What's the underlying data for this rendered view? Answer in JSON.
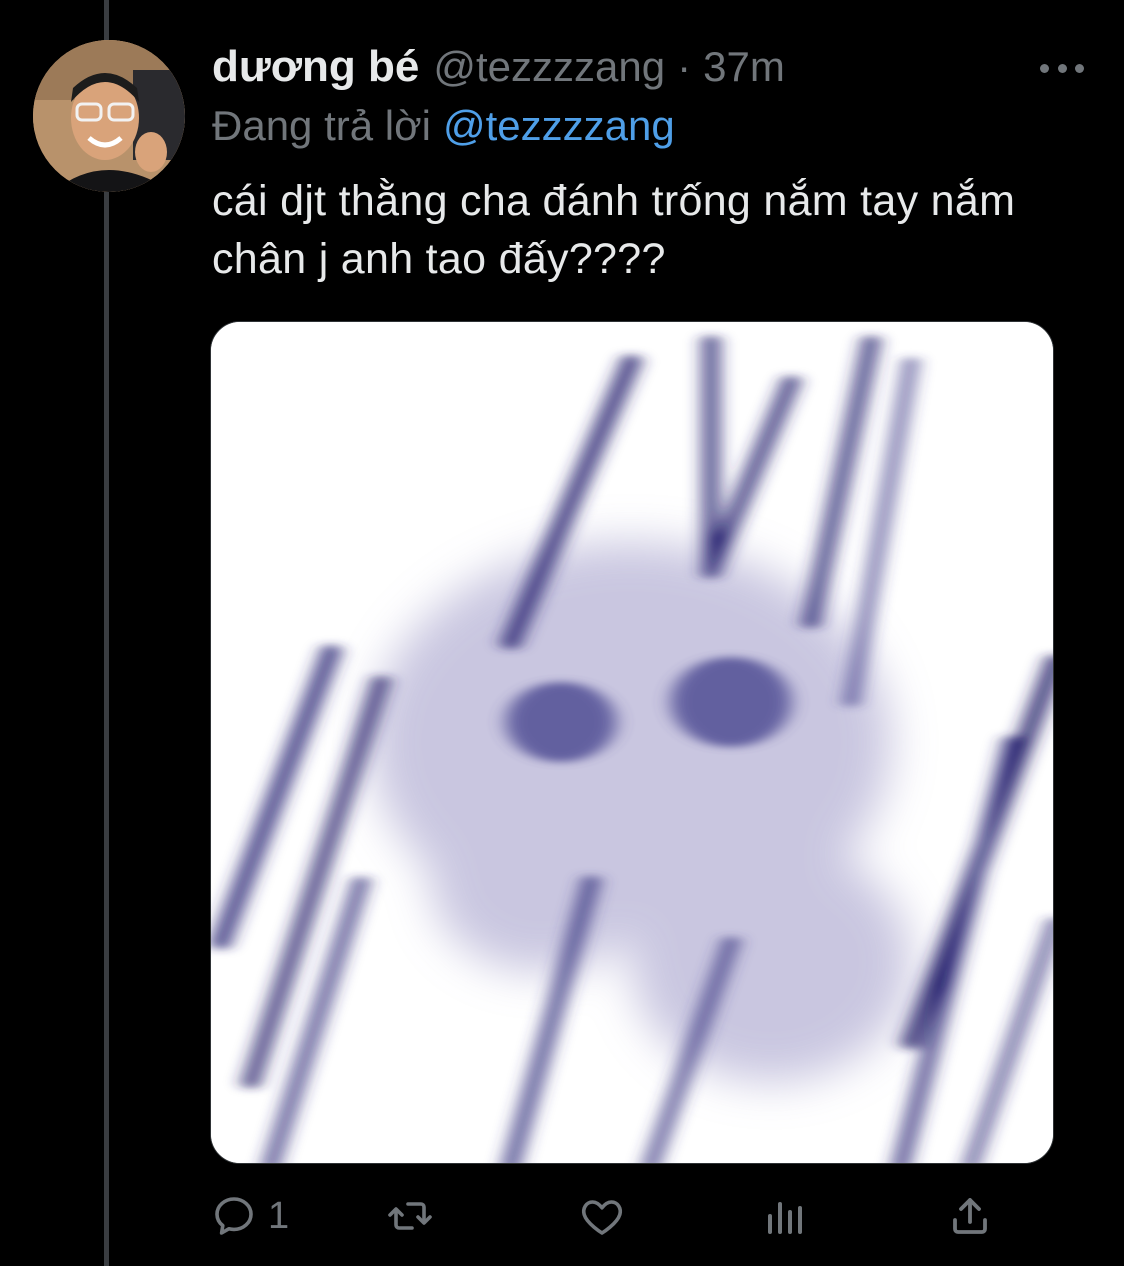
{
  "tweet": {
    "display_name": "dương bé",
    "handle": "@tezzzzang",
    "separator": "·",
    "time": "37m",
    "reply_prefix": "Đang trả lời",
    "reply_to": "@tezzzzang",
    "text": "cái djt thằng cha đánh trống nắm tay nắm chân j anh tao đấy????"
  },
  "actions": {
    "reply_count": "1"
  },
  "icons": {
    "more": "more-horizontal-icon",
    "reply": "reply-icon",
    "retweet": "retweet-icon",
    "like": "like-icon",
    "views": "analytics-icon",
    "share": "share-icon"
  },
  "colors": {
    "background": "#000000",
    "text_primary": "#e7e9ea",
    "text_secondary": "#71767b",
    "link": "#4f9fe8",
    "thread_line": "#3a3d41"
  }
}
